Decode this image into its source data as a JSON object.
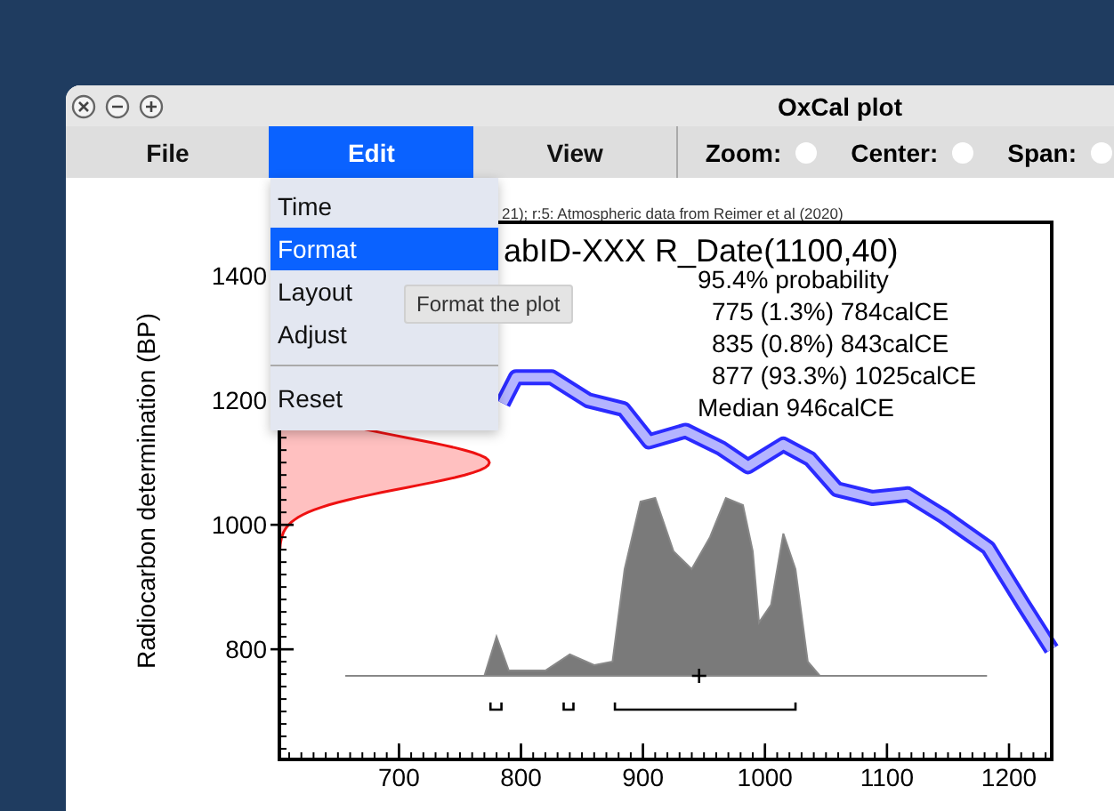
{
  "window": {
    "title": "OxCal plot"
  },
  "toolbar": {
    "menus": [
      {
        "label": "File",
        "selected": false
      },
      {
        "label": "Edit",
        "selected": true
      },
      {
        "label": "View",
        "selected": false
      }
    ],
    "options": [
      {
        "label": "Zoom:",
        "checked": false
      },
      {
        "label": "Center:",
        "checked": false
      },
      {
        "label": "Span:",
        "checked": false
      }
    ]
  },
  "menu": {
    "items": [
      {
        "kind": "item",
        "label": "Time",
        "selected": false
      },
      {
        "kind": "item",
        "label": "Format",
        "selected": true
      },
      {
        "kind": "item",
        "label": "Layout",
        "selected": false
      },
      {
        "kind": "item",
        "label": "Adjust",
        "selected": false
      },
      {
        "kind": "separator"
      },
      {
        "kind": "item",
        "label": "Reset",
        "selected": false
      }
    ]
  },
  "tooltip": "Format the plot",
  "plot": {
    "header": "21); r:5: Atmospheric data from Reimer et al (2020)",
    "title": "abID-XXX R_Date(1100,40)",
    "summary": {
      "heading": "95.4% probability",
      "ranges": [
        "775 (1.3%) 784calCE",
        "835 (0.8%) 843calCE",
        "877 (93.3%) 1025calCE"
      ],
      "median": "Median 946calCE"
    },
    "chart_data": {
      "type": "line",
      "ylabel": "Radiocarbon determination (BP)",
      "xlim": [
        602,
        1235
      ],
      "ylim": [
        623,
        1486
      ],
      "xticks": [
        700,
        800,
        900,
        1000,
        1100,
        1200
      ],
      "yticks": [
        800,
        1000,
        1200,
        1400
      ],
      "x": [
        785,
        796,
        825,
        855,
        884,
        905,
        935,
        964,
        986,
        1015,
        1037,
        1059,
        1088,
        1117,
        1146,
        1183,
        1212,
        1235
      ],
      "series": [
        {
          "color": "#2b2bff",
          "values": [
            1195,
            1237,
            1237,
            1200,
            1186,
            1134,
            1151,
            1123,
            1094,
            1129,
            1106,
            1057,
            1043,
            1049,
            1014,
            963,
            871,
            800
          ]
        }
      ]
    }
  }
}
